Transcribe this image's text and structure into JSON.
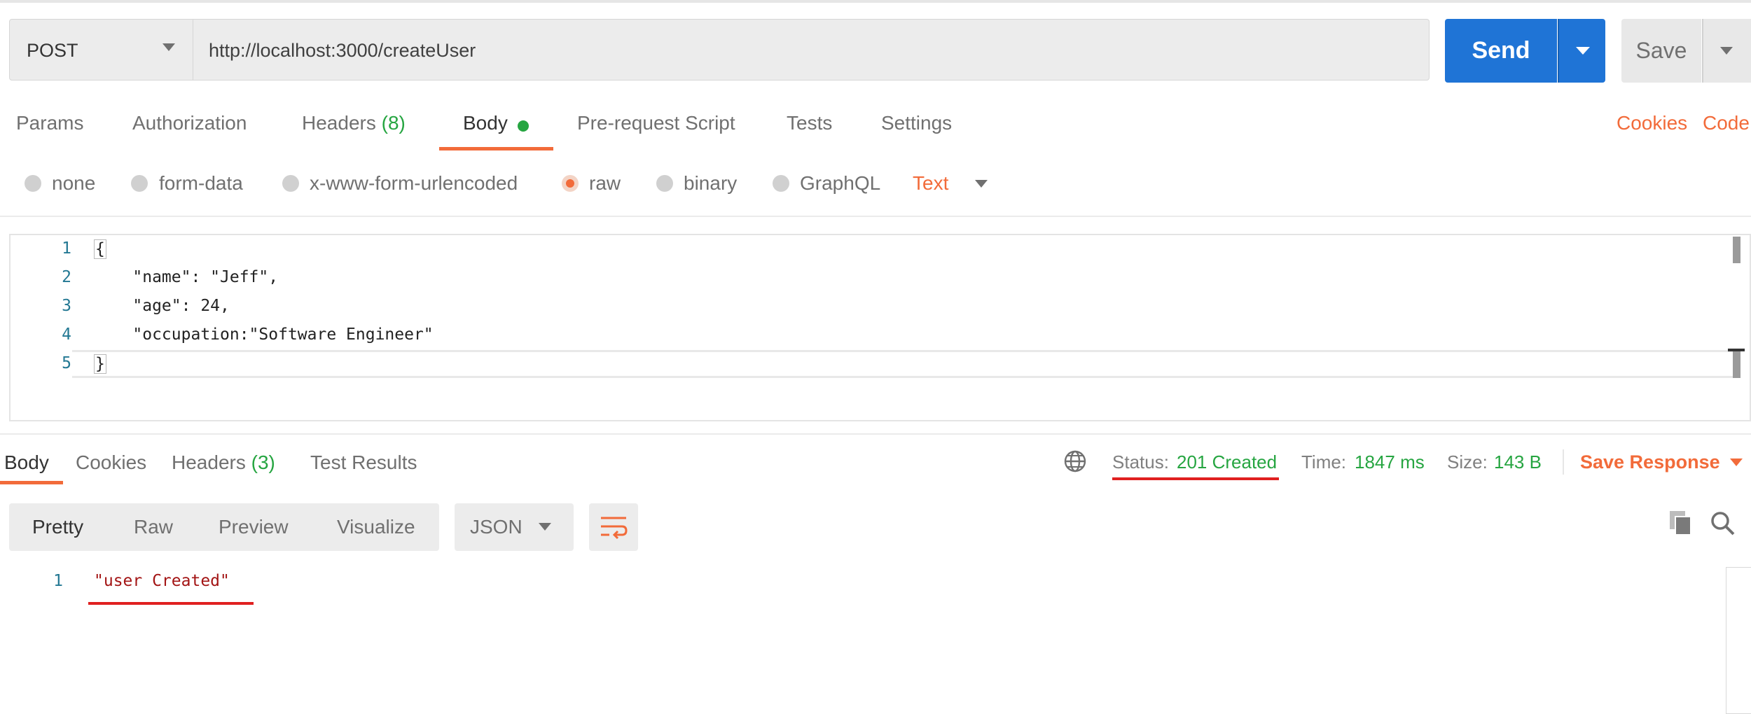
{
  "request": {
    "method": "POST",
    "url": "http://localhost:3000/createUser",
    "send_label": "Send",
    "save_label": "Save"
  },
  "request_tabs": {
    "params": "Params",
    "authorization": "Authorization",
    "headers": "Headers",
    "headers_count": "(8)",
    "body": "Body",
    "pre_request_script": "Pre-request Script",
    "tests": "Tests",
    "settings": "Settings",
    "active": "Body"
  },
  "links": {
    "cookies": "Cookies",
    "code": "Code"
  },
  "body_types": {
    "none": "none",
    "form_data": "form-data",
    "urlencoded": "x-www-form-urlencoded",
    "raw": "raw",
    "binary": "binary",
    "graphql": "GraphQL",
    "selected": "raw",
    "format": "Text"
  },
  "editor": {
    "lines": [
      {
        "num": "1",
        "text": "{"
      },
      {
        "num": "2",
        "text": "    \"name\": \"Jeff\","
      },
      {
        "num": "3",
        "text": "    \"age\": 24,"
      },
      {
        "num": "4",
        "text": "    \"occupation:\"Software Engineer\""
      },
      {
        "num": "5",
        "text": "}"
      }
    ]
  },
  "response_tabs": {
    "body": "Body",
    "cookies": "Cookies",
    "headers": "Headers",
    "headers_count": "(3)",
    "test_results": "Test Results",
    "active": "Body"
  },
  "response_meta": {
    "status_label": "Status:",
    "status_value": "201 Created",
    "time_label": "Time:",
    "time_value": "1847 ms",
    "size_label": "Size:",
    "size_value": "143 B",
    "save_response": "Save Response"
  },
  "response_view": {
    "pretty": "Pretty",
    "raw": "Raw",
    "preview": "Preview",
    "visualize": "Visualize",
    "selected": "Pretty",
    "language": "JSON"
  },
  "response_body": {
    "lines": [
      {
        "num": "1",
        "text": "\"user Created\""
      }
    ]
  },
  "colors": {
    "accent": "#f26b3a",
    "send": "#1f74d6",
    "success": "#26a541",
    "annotation": "#e02020"
  }
}
